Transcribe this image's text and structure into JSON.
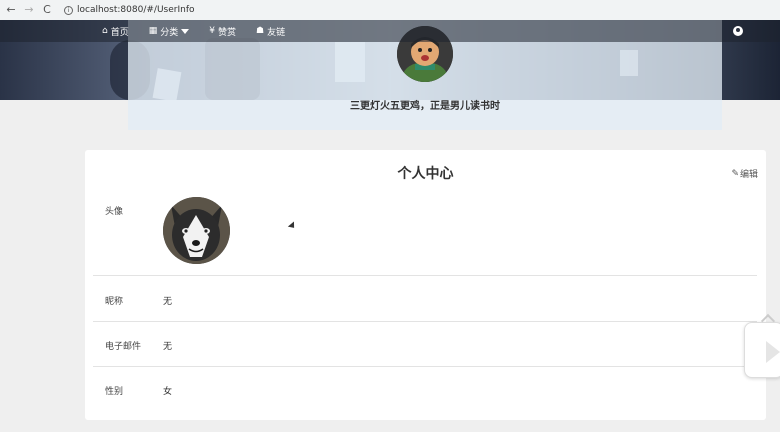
{
  "browser": {
    "back": "←",
    "forward": "→",
    "reload": "C",
    "info": "i",
    "url": "localhost:8080/#/UserInfo"
  },
  "nav": {
    "items": [
      {
        "icon": "home-icon",
        "glyph": "⌂",
        "label": "首页"
      },
      {
        "icon": "category-icon",
        "glyph": "▦",
        "label": "分类"
      },
      {
        "icon": "yen-icon",
        "glyph": "¥",
        "label": "赞赏"
      },
      {
        "icon": "friends-icon",
        "glyph": "☗",
        "label": "友链"
      }
    ]
  },
  "intro": {
    "motto": "三更灯火五更鸡，正是男儿读书时"
  },
  "profile": {
    "title": "个人中心",
    "edit_icon_glyph": "✎",
    "edit_label": "编辑",
    "avatar_label": "头像",
    "nickname_label": "昵称",
    "nickname_value": "无",
    "email_label": "电子邮件",
    "email_value": "无",
    "gender_label": "性别",
    "gender_value": "女"
  },
  "colors": {
    "nav_text": "#ffffff",
    "card_bg": "#ffffff",
    "page_bg": "#efefef"
  }
}
